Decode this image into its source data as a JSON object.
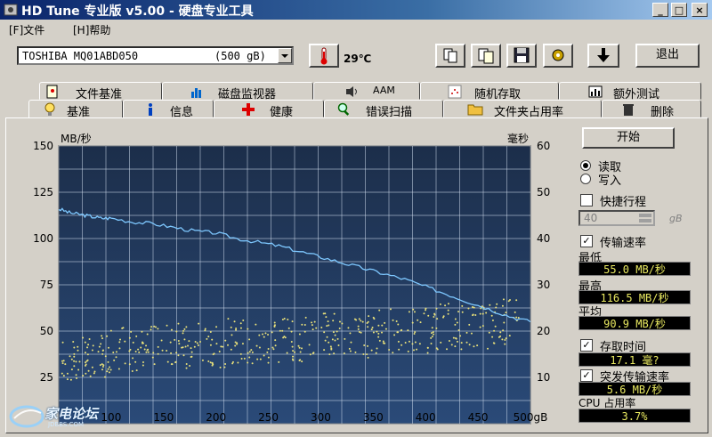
{
  "window": {
    "title": "HD Tune 专业版 v5.00 - 硬盘专业工具"
  },
  "menu": [
    "[F]文件",
    "[H]帮助"
  ],
  "toolbar": {
    "drive_name": "TOSHIBA MQ01ABD050",
    "drive_capacity": "(500 gB)",
    "temperature": "29℃",
    "exit_label": "退出"
  },
  "tabs_top": [
    "文件基准",
    "磁盘监视器",
    "AAM",
    "随机存取",
    "额外测试"
  ],
  "tabs_bottom": [
    "基准",
    "信息",
    "健康",
    "错误扫描",
    "文件夹占用率",
    "删除"
  ],
  "chart_data": {
    "type": "line",
    "title": "",
    "ylabel_left": "MB/秒",
    "ylabel_right": "毫秒",
    "xunit": "gB",
    "y_left_ticks": [
      150,
      125,
      100,
      75,
      50,
      25
    ],
    "y_right_ticks": [
      60,
      50,
      40,
      30,
      20,
      10
    ],
    "x_ticks": [
      100,
      150,
      200,
      250,
      300,
      350,
      400,
      450,
      "500gB"
    ],
    "ylim_left": [
      0,
      150
    ],
    "ylim_right": [
      0,
      60
    ],
    "xlim": [
      50,
      500
    ],
    "grid": true,
    "series": [
      {
        "name": "传输速率",
        "color": "#7ec8ff",
        "x": [
          50,
          60,
          70,
          80,
          90,
          100,
          120,
          140,
          160,
          180,
          200,
          220,
          240,
          260,
          280,
          300,
          320,
          340,
          360,
          380,
          400,
          420,
          440,
          460,
          480,
          500
        ],
        "values": [
          116,
          114,
          113,
          112,
          111,
          111,
          109,
          108,
          106,
          104,
          103,
          100,
          98,
          96,
          93,
          90,
          87,
          84,
          81,
          78,
          74,
          70,
          66,
          62,
          58,
          55
        ]
      },
      {
        "name": "存取时间",
        "type": "scatter",
        "color": "#e8e07a",
        "x": [
          55,
          70,
          85,
          100,
          120,
          140,
          160,
          180,
          200,
          220,
          240,
          260,
          280,
          300,
          320,
          340,
          360,
          380,
          400,
          420,
          440,
          460,
          480
        ],
        "values": [
          13,
          14,
          15,
          16,
          16,
          17,
          17,
          17,
          17,
          18,
          18,
          18,
          18,
          19,
          19,
          19,
          20,
          20,
          20,
          21,
          21,
          21,
          22
        ]
      }
    ]
  },
  "right_panel": {
    "start_label": "开始",
    "read_label": "读取",
    "write_label": "写入",
    "short_stroke_label": "快捷行程",
    "short_stroke_value": "40",
    "short_stroke_unit": "gB",
    "transfer_rate_label": "传输速率",
    "min_label": "最低",
    "min_value": "55.0 MB/秒",
    "max_label": "最高",
    "max_value": "116.5 MB/秒",
    "avg_label": "平均",
    "avg_value": "90.9 MB/秒",
    "access_time_label": "存取时间",
    "access_time_value": "17.1 毫?",
    "burst_label": "突发传输速率",
    "burst_value": "5.6 MB/秒",
    "cpu_label": "CPU 占用率",
    "cpu_value": "3.7%"
  },
  "watermark": {
    "text": "家电论坛",
    "sub": "JDBBS.COM"
  }
}
